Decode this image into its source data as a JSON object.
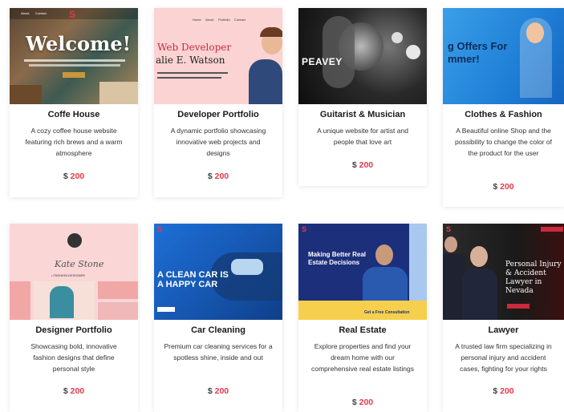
{
  "cards": [
    {
      "title": "Coffe House",
      "description": "A cozy coffee house website featuring rich brews and a warm atmosphere",
      "currency": "$",
      "price": "200",
      "thumb_heading": "Welcome!",
      "thumb_nav": [
        "About",
        "Contact"
      ]
    },
    {
      "title": "Developer Portfolio",
      "description": "A dynamic portfolio showcasing innovative web projects and designs",
      "currency": "$",
      "price": "200",
      "thumb_heading": "Web Developer",
      "thumb_subheading": "alie E. Watson",
      "thumb_nav": [
        "Home",
        "About",
        "Portfolio",
        "Contact"
      ]
    },
    {
      "title": "Guitarist & Musician",
      "description": "A unique website for artist and people that love art",
      "currency": "$",
      "price": "200",
      "thumb_heading": "PEAVEY"
    },
    {
      "title": "Clothes & Fashion",
      "description": "A Beautiful online Shop and the possibility to change the color of the product for the user",
      "currency": "$",
      "price": "200",
      "thumb_heading": "g Offers For",
      "thumb_subheading": "mmer!"
    },
    {
      "title": "Designer Portfolio",
      "description": "Showcasing bold, innovative fashion designs that define personal style",
      "currency": "$",
      "price": "200",
      "thumb_heading": "Kate Stone",
      "thumb_subheading": "• FASHION DESIGNER"
    },
    {
      "title": "Car Cleaning",
      "description": "Premium car cleaning services for a spotless shine, inside and out",
      "currency": "$",
      "price": "200",
      "thumb_heading": "A CLEAN CAR IS A HAPPY CAR"
    },
    {
      "title": "Real Estate",
      "description": "Explore properties and find your dream home with our comprehensive real estate listings",
      "currency": "$",
      "price": "200",
      "thumb_heading": "Making Better Real Estate Decisions",
      "thumb_subheading": "Get a Free Consultation"
    },
    {
      "title": "Lawyer",
      "description": "A trusted law firm specializing in personal injury and accident cases, fighting for your rights",
      "currency": "$",
      "price": "200",
      "thumb_heading": "Personal Injury & Accident Lawyer in Nevada"
    }
  ],
  "colors": {
    "price_accent": "#e5394b",
    "card_background": "#ffffff",
    "page_background": "#ffffff"
  }
}
